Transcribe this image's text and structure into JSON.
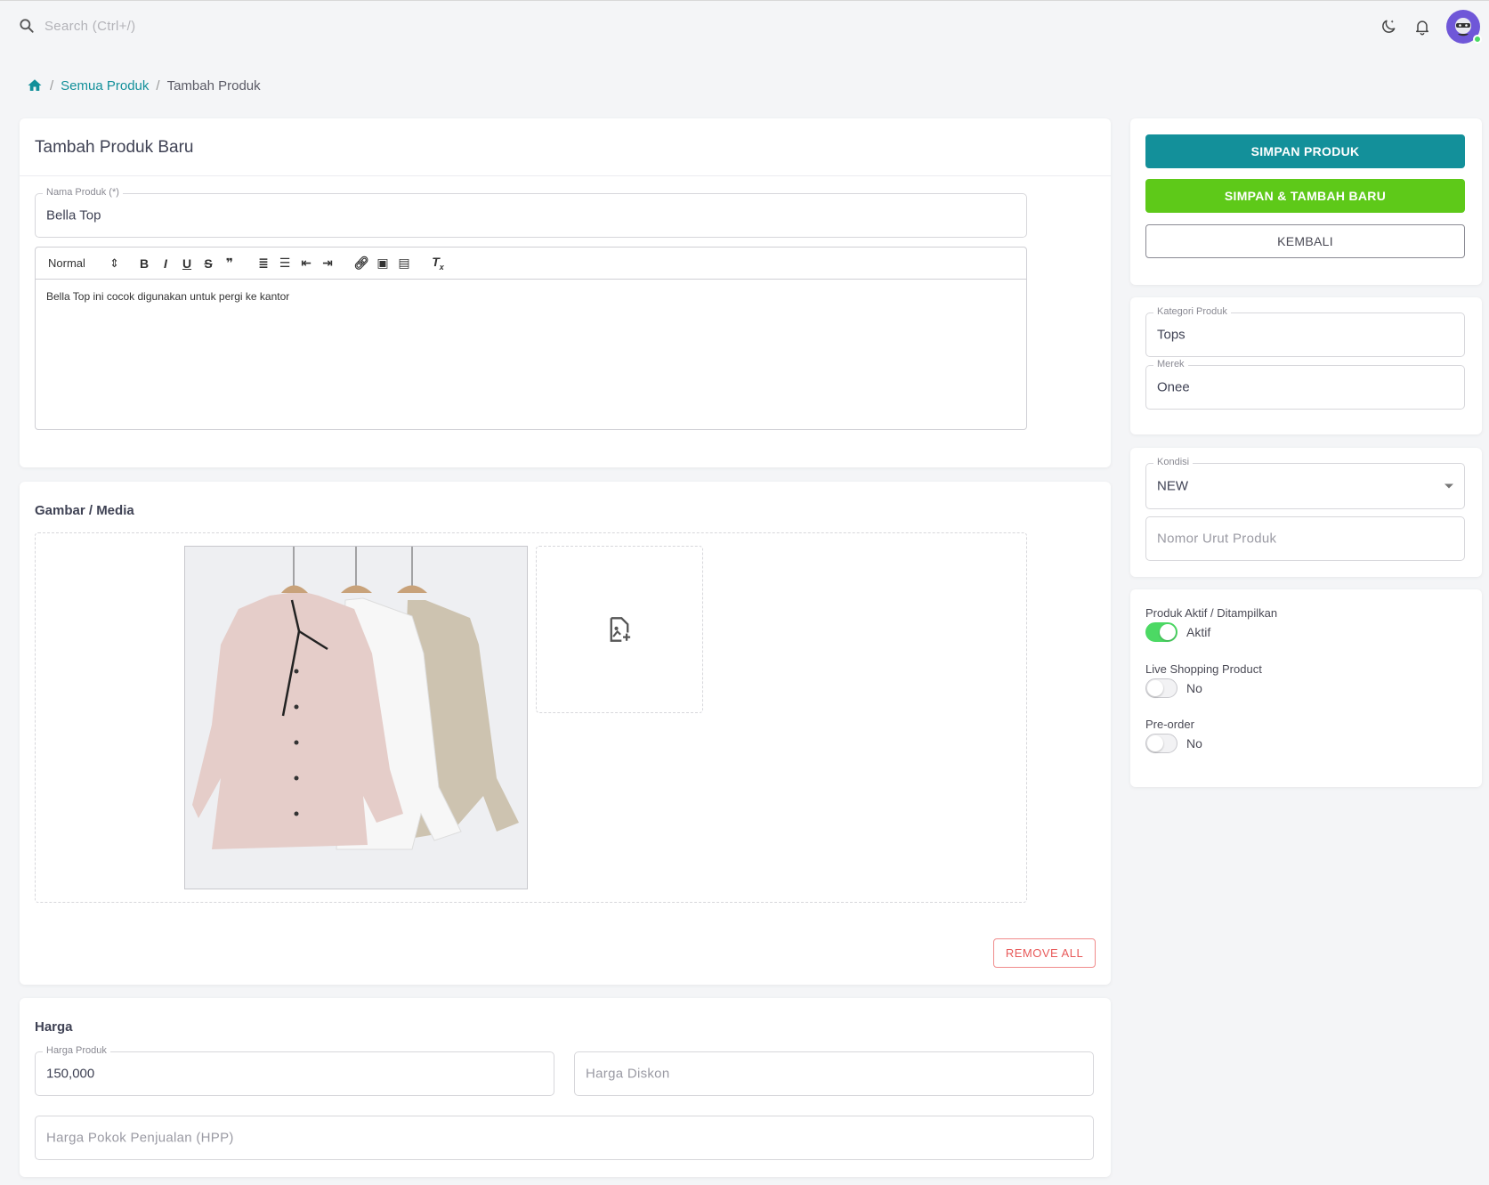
{
  "topbar": {
    "search_placeholder": "Search (Ctrl+/)"
  },
  "breadcrumb": {
    "home_icon": "home-icon",
    "items": [
      "Semua Produk",
      "Tambah Produk"
    ]
  },
  "main": {
    "title": "Tambah Produk Baru",
    "nama_produk": {
      "label": "Nama Produk (*)",
      "value": "Bella Top"
    },
    "editor": {
      "format_select": "Normal",
      "toolbar_icons": [
        "bold",
        "italic",
        "underline",
        "strike",
        "blockquote",
        "ordered-list",
        "bullet-list",
        "indent-decrease",
        "indent-increase",
        "link",
        "image",
        "video",
        "clear-format"
      ],
      "content": "Bella Top ini cocok digunakan untuk pergi ke kantor"
    }
  },
  "media": {
    "title": "Gambar / Media",
    "add_icon": "add-image-icon",
    "remove_all": "REMOVE ALL"
  },
  "harga": {
    "title": "Harga",
    "harga_produk": {
      "label": "Harga Produk",
      "value": "150,000"
    },
    "harga_diskon_placeholder": "Harga Diskon",
    "hpp_placeholder": "Harga Pokok Penjualan (HPP)"
  },
  "actions": {
    "save": "SIMPAN PRODUK",
    "save_new": "SIMPAN & TAMBAH BARU",
    "back": "KEMBALI",
    "colors": {
      "primary": "#13909a",
      "green": "#5ec919"
    }
  },
  "category": {
    "kategori": {
      "label": "Kategori Produk",
      "value": "Tops"
    },
    "merek": {
      "label": "Merek",
      "value": "Onee"
    }
  },
  "condition": {
    "kondisi": {
      "label": "Kondisi",
      "value": "NEW"
    },
    "nomor_urut_placeholder": "Nomor Urut Produk"
  },
  "toggles": {
    "aktif": {
      "label": "Produk Aktif / Ditampilkan",
      "state": "Aktif",
      "on": true
    },
    "live": {
      "label": "Live Shopping Product",
      "state": "No",
      "on": false
    },
    "preorder": {
      "label": "Pre-order",
      "state": "No",
      "on": false
    }
  }
}
